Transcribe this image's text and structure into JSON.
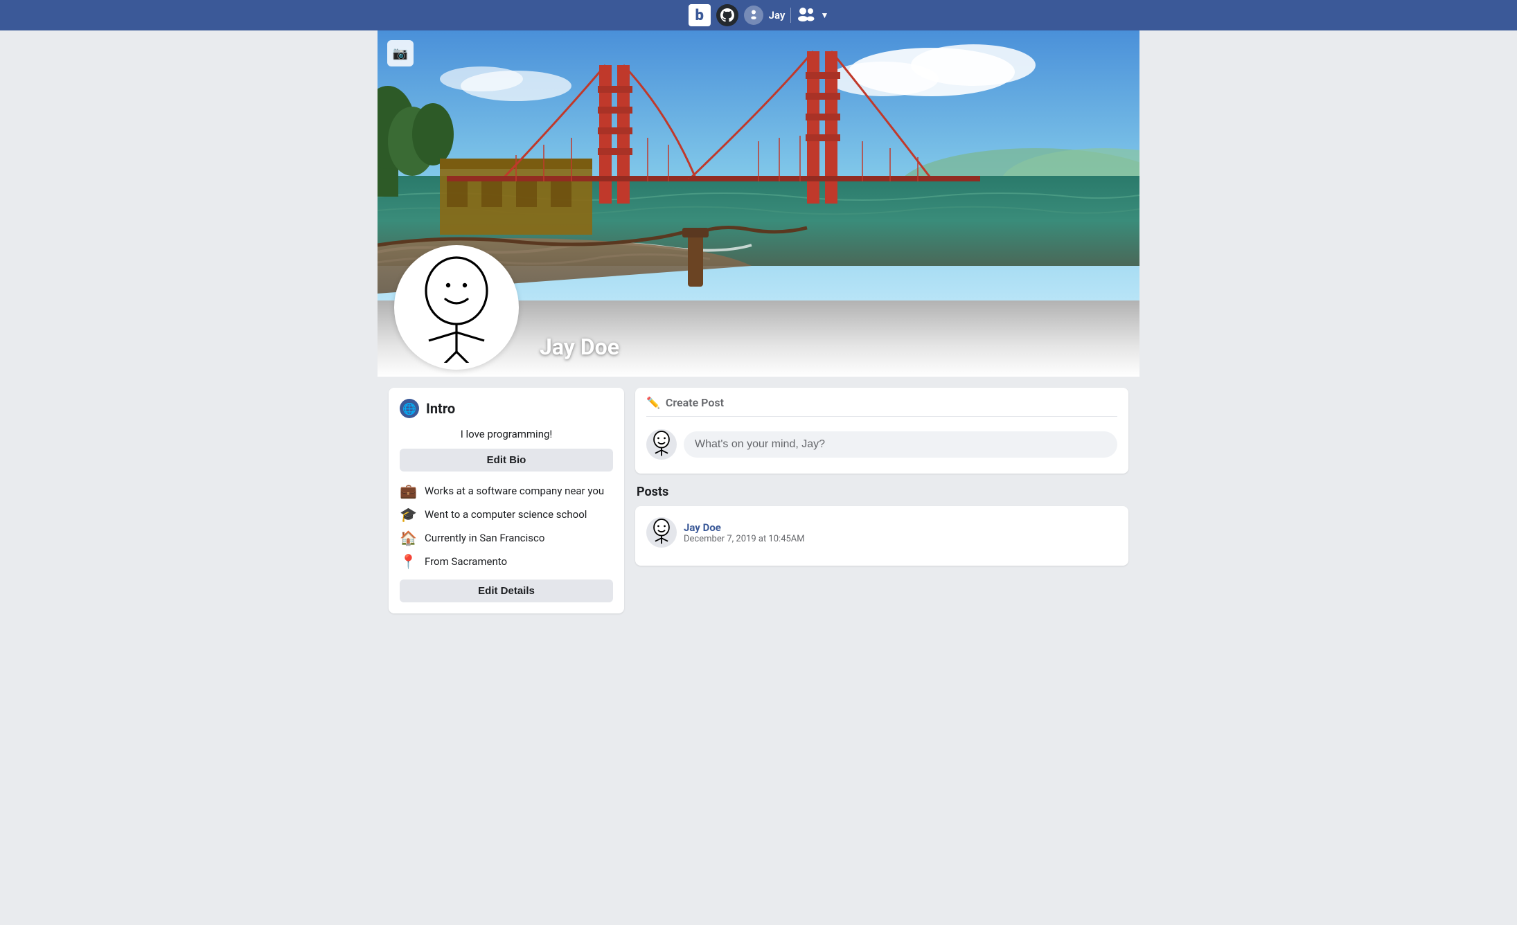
{
  "navbar": {
    "logo_b": "b",
    "github_icon": "⌥",
    "username": "Jay",
    "friends_icon": "👥",
    "caret": "▼"
  },
  "profile": {
    "name": "Jay Doe",
    "cover_alt": "Golden Gate Bridge San Francisco",
    "bio": "I love programming!",
    "edit_bio_label": "Edit Bio",
    "edit_details_label": "Edit Details",
    "details": [
      {
        "icon": "💼",
        "text": "Works at a software company near you"
      },
      {
        "icon": "🎓",
        "text": "Went to a computer science school"
      },
      {
        "icon": "🏠",
        "text": "Currently in San Francisco"
      },
      {
        "icon": "📍",
        "text": "From Sacramento"
      }
    ]
  },
  "intro": {
    "title": "Intro",
    "globe_icon": "🌐"
  },
  "create_post": {
    "header_title": "Create Post",
    "placeholder": "What's on your mind, Jay?"
  },
  "posts": {
    "section_label": "Posts",
    "items": [
      {
        "author": "Jay Doe",
        "timestamp": "December 7, 2019 at 10:45AM",
        "content": ""
      }
    ]
  }
}
